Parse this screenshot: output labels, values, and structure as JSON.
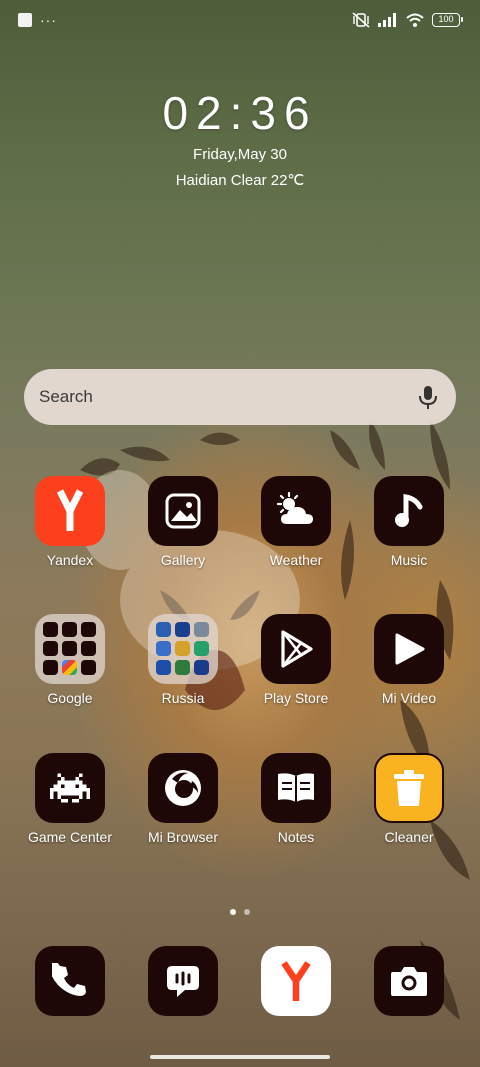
{
  "status_bar": {
    "notification_icon": "square-notification-icon",
    "more_indicator": "···",
    "battery_level": "100",
    "icons": [
      "mute-vibrate-icon",
      "signal-icon",
      "wifi-icon",
      "battery-icon"
    ]
  },
  "clock": {
    "time": "02:36",
    "date": "Friday,May 30",
    "weather": "Haidian Clear 22℃"
  },
  "search": {
    "placeholder": "Search",
    "icon": "mic-icon"
  },
  "apps": {
    "row1": [
      {
        "label": "Yandex",
        "icon": "yandex-icon"
      },
      {
        "label": "Gallery",
        "icon": "gallery-icon"
      },
      {
        "label": "Weather",
        "icon": "weather-icon"
      },
      {
        "label": "Music",
        "icon": "music-icon"
      }
    ],
    "row2": [
      {
        "label": "Google",
        "icon": "google-folder-icon"
      },
      {
        "label": "Russia",
        "icon": "russia-folder-icon"
      },
      {
        "label": "Play Store",
        "icon": "play-store-icon"
      },
      {
        "label": "Mi Video",
        "icon": "mi-video-icon"
      }
    ],
    "row3": [
      {
        "label": "Game Center",
        "icon": "game-center-icon"
      },
      {
        "label": "Mi Browser",
        "icon": "mi-browser-icon"
      },
      {
        "label": "Notes",
        "icon": "notes-icon"
      },
      {
        "label": "Cleaner",
        "icon": "cleaner-icon"
      }
    ]
  },
  "dock": [
    {
      "icon": "phone-icon"
    },
    {
      "icon": "messages-icon"
    },
    {
      "icon": "yandex-browser-icon"
    },
    {
      "icon": "camera-icon"
    }
  ],
  "pager": {
    "pages": 2,
    "current": 1
  },
  "colors": {
    "icon_bg": "#1e0707",
    "yandex_red": "#fc3f1d",
    "cleaner_yellow": "#f9b321"
  }
}
